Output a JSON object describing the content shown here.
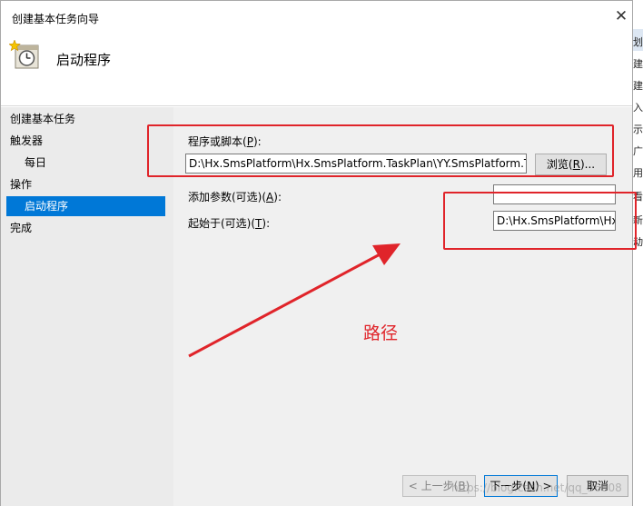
{
  "dialog": {
    "title": "创建基本任务向导",
    "close": "✕",
    "header_title": "启动程序"
  },
  "nav": [
    {
      "label": "创建基本任务"
    },
    {
      "label": "触发器"
    },
    {
      "label": "每日"
    },
    {
      "label": "操作"
    },
    {
      "label": "启动程序"
    },
    {
      "label": "完成"
    }
  ],
  "form": {
    "program_label": {
      "pre": "程序或脚本(",
      "key": "P",
      "post": "):"
    },
    "program_value": "D:\\Hx.SmsPlatform\\Hx.SmsPlatform.TaskPlan\\YY.SmsPlatform.Tas",
    "browse": {
      "pre": "浏览(",
      "key": "R",
      "post": ")..."
    },
    "args_label": {
      "pre": "添加参数(可选)(",
      "key": "A",
      "post": "):"
    },
    "args_value": "",
    "start_label": {
      "pre": "起始于(可选)(",
      "key": "T",
      "post": "):"
    },
    "start_value": "D:\\Hx.SmsPlatform\\Hx"
  },
  "footer": {
    "back": {
      "pre": "< 上一步(",
      "key": "B",
      "post": ")"
    },
    "next": {
      "pre": "下一步(",
      "key": "N",
      "post": ") >"
    },
    "cancel": "取消"
  },
  "annotation": {
    "text": "路径",
    "color": "#e0242a"
  },
  "background_window": {
    "chars": [
      "划",
      "建",
      "建",
      "入",
      "示",
      "广",
      "用",
      "看",
      "新",
      "动"
    ]
  },
  "watermark": "https://blog.csdn.net/qq_36008",
  "colors": {
    "selection": "#0078d7",
    "annotation": "#e0242a"
  }
}
